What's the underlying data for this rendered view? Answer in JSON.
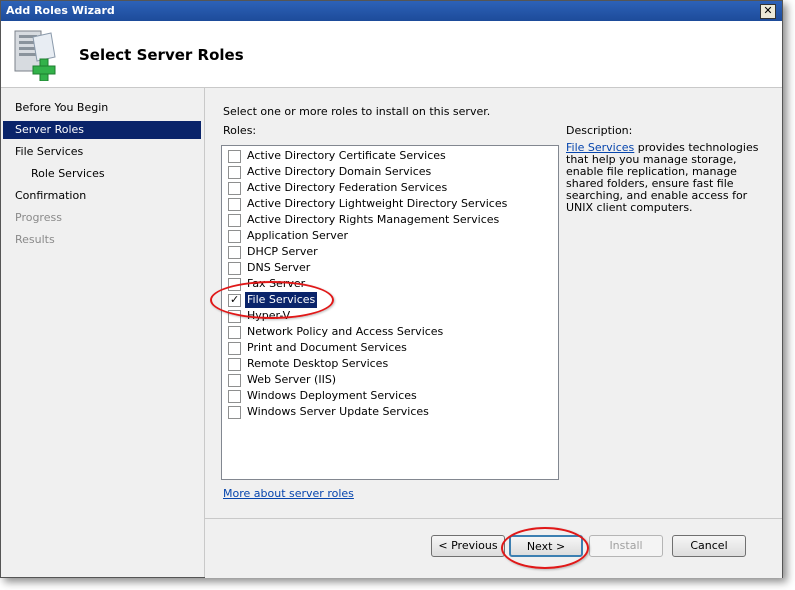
{
  "window": {
    "title": "Add Roles Wizard",
    "close_glyph": "✕"
  },
  "header": {
    "title": "Select Server Roles",
    "icon": "server-roles-icon"
  },
  "nav": {
    "items": [
      {
        "label": "Before You Begin",
        "state": "normal"
      },
      {
        "label": "Server Roles",
        "state": "selected"
      },
      {
        "label": "File Services",
        "state": "normal"
      },
      {
        "label": "Role Services",
        "state": "normal"
      },
      {
        "label": "Confirmation",
        "state": "normal"
      },
      {
        "label": "Progress",
        "state": "disabled"
      },
      {
        "label": "Results",
        "state": "disabled"
      }
    ]
  },
  "content": {
    "instruction": "Select one or more roles to install on this server.",
    "roles_label": "Roles:",
    "roles": [
      {
        "label": "Active Directory Certificate Services",
        "checked": false
      },
      {
        "label": "Active Directory Domain Services",
        "checked": false
      },
      {
        "label": "Active Directory Federation Services",
        "checked": false
      },
      {
        "label": "Active Directory Lightweight Directory Services",
        "checked": false
      },
      {
        "label": "Active Directory Rights Management Services",
        "checked": false
      },
      {
        "label": "Application Server",
        "checked": false
      },
      {
        "label": "DHCP Server",
        "checked": false
      },
      {
        "label": "DNS Server",
        "checked": false
      },
      {
        "label": "Fax Server",
        "checked": false
      },
      {
        "label": "File Services",
        "checked": true,
        "selected": true
      },
      {
        "label": "Hyper-V",
        "checked": false
      },
      {
        "label": "Network Policy and Access Services",
        "checked": false
      },
      {
        "label": "Print and Document Services",
        "checked": false
      },
      {
        "label": "Remote Desktop Services",
        "checked": false
      },
      {
        "label": "Web Server (IIS)",
        "checked": false
      },
      {
        "label": "Windows Deployment Services",
        "checked": false
      },
      {
        "label": "Windows Server Update Services",
        "checked": false
      }
    ],
    "more_link": "More about server roles",
    "description_label": "Description:",
    "description_link": "File Services",
    "description_text": " provides technologies that help you manage storage, enable file replication, manage shared folders, ensure fast file searching, and enable access for UNIX client computers."
  },
  "buttons": {
    "previous": "< Previous",
    "next": "Next >",
    "install": "Install",
    "cancel": "Cancel"
  },
  "colors": {
    "selection": "#0a246a",
    "annotation": "#e01818",
    "link": "#0645ad"
  }
}
